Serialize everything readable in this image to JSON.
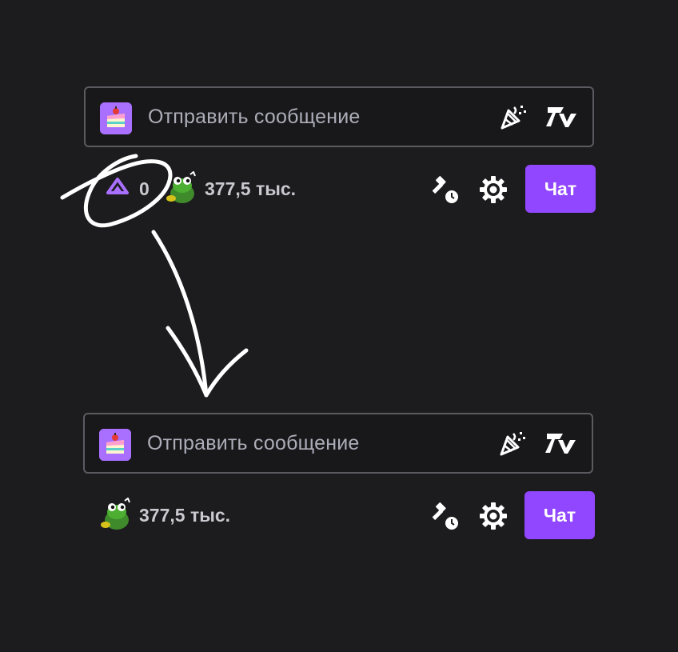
{
  "before": {
    "input": {
      "placeholder": "Отправить сообщение"
    },
    "points": {
      "count": "0"
    },
    "viewers": {
      "count": "377,5 тыс."
    },
    "chat_button": {
      "label": "Чат"
    }
  },
  "after": {
    "input": {
      "placeholder": "Отправить сообщение"
    },
    "viewers": {
      "count": "377,5 тыс."
    },
    "chat_button": {
      "label": "Чат"
    }
  },
  "icons": {
    "emote": "cake-emote-icon",
    "party": "party-popper-icon",
    "seventv": "7tv-logo-icon",
    "points": "channel-points-icon",
    "viewers": "frog-emote-icon",
    "mod": "gavel-clock-icon",
    "settings": "gear-icon"
  },
  "colors": {
    "background": "#1c1b1e",
    "accent": "#9147ff",
    "points": "#a970ff",
    "text": "#efeff1"
  }
}
